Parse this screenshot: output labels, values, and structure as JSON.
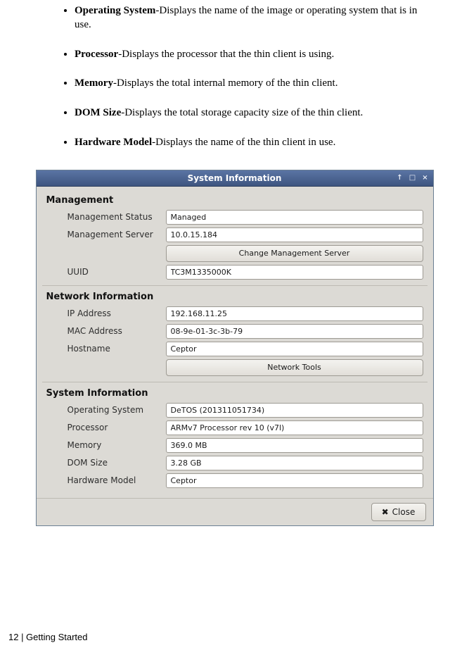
{
  "bullets": [
    {
      "term": "Operating System",
      "desc": "-Displays the name of the image or operating system that is in use."
    },
    {
      "term": "Processor",
      "desc": "-Displays the processor that the thin client is using."
    },
    {
      "term": "Memory",
      "desc": "-Displays the total internal memory of the thin client."
    },
    {
      "term": "DOM Size",
      "desc": "-Displays the total storage capacity size of the thin client."
    },
    {
      "term": "Hardware Model",
      "desc": "-Displays the name of the thin client in use."
    }
  ],
  "dialog": {
    "title": "System Information",
    "titlebar_icons": {
      "minimize": "↑",
      "maximize": "□",
      "close": "×"
    },
    "sections": {
      "management": {
        "header": "Management",
        "status_label": "Management Status",
        "status_value": "Managed",
        "server_label": "Management Server",
        "server_value": "10.0.15.184",
        "change_button": "Change Management Server",
        "uuid_label": "UUID",
        "uuid_value": "TC3M1335000K"
      },
      "network": {
        "header": "Network Information",
        "ip_label": "IP Address",
        "ip_value": "192.168.11.25",
        "mac_label": "MAC Address",
        "mac_value": "08-9e-01-3c-3b-79",
        "host_label": "Hostname",
        "host_value": "Ceptor",
        "tools_button": "Network Tools"
      },
      "system": {
        "header": "System Information",
        "os_label": "Operating System",
        "os_value": "DeTOS (201311051734)",
        "proc_label": "Processor",
        "proc_value": "ARMv7 Processor rev 10 (v7l)",
        "mem_label": "Memory",
        "mem_value": "369.0 MB",
        "dom_label": "DOM Size",
        "dom_value": "3.28 GB",
        "hw_label": "Hardware Model",
        "hw_value": "Ceptor"
      }
    },
    "close_button": "Close"
  },
  "footer": "12 | Getting Started"
}
